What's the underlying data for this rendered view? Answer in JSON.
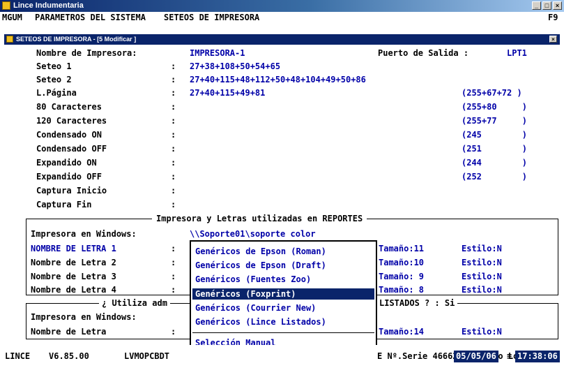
{
  "window": {
    "title": "Lince Indumentaria",
    "buttons": [
      "_",
      "□",
      "×"
    ]
  },
  "menubar": {
    "items": [
      "MGUM",
      "PARAMETROS DEL SISTEMA",
      "SETEOS DE IMPRESORA"
    ],
    "hotkey": "F9"
  },
  "dialog": {
    "title": "SETEOS DE IMPRESORA - [5 Modificar ]",
    "close": "×"
  },
  "printer": {
    "name_label": "Nombre de Impresora:",
    "name_value": "IMPRESORA-1",
    "port_label": "Puerto de Salida :",
    "port_value": "LPT1",
    "rows": [
      {
        "label": "Seteo 1",
        "colon": ":",
        "value": "27+38+108+50+54+65",
        "right": ""
      },
      {
        "label": "Seteo 2",
        "colon": ":",
        "value": "27+40+115+48+112+50+48+104+49+50+86",
        "right": ""
      },
      {
        "label": "L.Página",
        "colon": ":",
        "value": "27+40+115+49+81",
        "right": "(255+67+72 )"
      },
      {
        "label": "80 Caracteres",
        "colon": ":",
        "value": "",
        "right": "(255+80     )"
      },
      {
        "label": "120 Caracteres",
        "colon": ":",
        "value": "",
        "right": "(255+77     )"
      },
      {
        "label": "Condensado ON",
        "colon": ":",
        "value": "",
        "right": "(245        )"
      },
      {
        "label": "Condensado OFF",
        "colon": ":",
        "value": "",
        "right": "(251        )"
      },
      {
        "label": "Expandido ON",
        "colon": ":",
        "value": "",
        "right": "(244        )"
      },
      {
        "label": "Expandido OFF",
        "colon": ":",
        "value": "",
        "right": "(252        )"
      },
      {
        "label": "Captura Inicio",
        "colon": ":",
        "value": "",
        "right": ""
      },
      {
        "label": "Captura Fin",
        "colon": ":",
        "value": "",
        "right": ""
      }
    ]
  },
  "reports": {
    "title": "Impresora y Letras utilizadas en REPORTES",
    "printer_label": "Impresora en Windows:",
    "printer_value": "\\\\Soporte01\\soporte color",
    "fonts": [
      {
        "label": "NOMBRE DE LETRA 1",
        "colon": ":",
        "size": "Tamaño:11",
        "style": "Estilo:N"
      },
      {
        "label": "Nombre de Letra 2",
        "colon": ":",
        "size": "Tamaño:10",
        "style": "Estilo:N"
      },
      {
        "label": "Nombre de Letra 3",
        "colon": ":",
        "size": "Tamaño: 9",
        "style": "Estilo:N"
      },
      {
        "label": "Nombre de Letra 4",
        "colon": ":",
        "size": "Tamaño: 8",
        "style": "Estilo:N"
      }
    ]
  },
  "listados": {
    "title_left": "¿ Utiliza adm",
    "title_right": "LISTADOS ? : Si",
    "printer_label": "Impresora en Windows:",
    "font_label": "Nombre de Letra",
    "colon": ":",
    "size": "Tamaño:14",
    "style": "Estilo:N"
  },
  "popup": {
    "items": [
      "Genéricos de Epson (Roman)",
      "Genéricos de Epson (Draft)",
      "Genéricos (Fuentes Zoo)",
      "Genéricos (Foxprint)",
      "Genéricos (Courrier New)",
      "Genéricos (Lince Listados)"
    ],
    "selected": "Genéricos (Foxprint)",
    "manual": "Selección Manual"
  },
  "status": {
    "app": "LINCE",
    "version": "V6.85.00",
    "module": "LVMOPCBDT",
    "license": "E Nº.Serie 466621 (C) Zoo Logic",
    "date": "05/05/06",
    "sep": "≡",
    "time": "17:38:06"
  },
  "colors": {
    "title": "#0a246a",
    "field_blue": "#0000a8",
    "chrome": "#d4d0c8"
  }
}
